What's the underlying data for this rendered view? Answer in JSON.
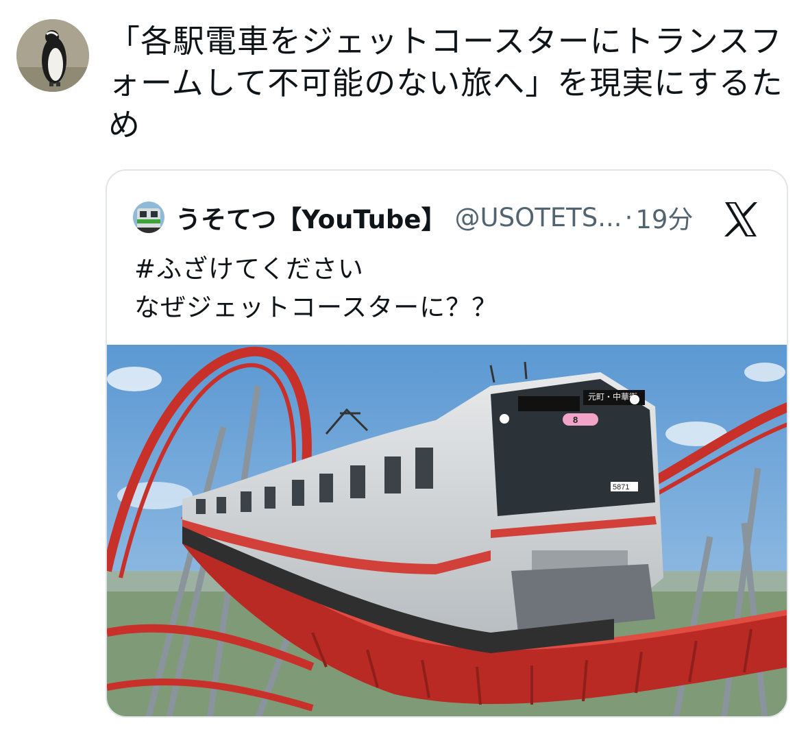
{
  "tweet": {
    "text": "「各駅電車をジェットコースターにトランスフォームして不可能のない旅へ」を現実にするため"
  },
  "quote": {
    "display_name": "うそてつ【YouTube】",
    "handle": "@USOTETS...",
    "separator": "·",
    "time": "19分",
    "text": "#ふざけてください\nなぜジェットコースターに？？",
    "image_caption_text": {
      "car_count": "8",
      "destination": "元町・中華街",
      "car_number": "5871"
    }
  },
  "icons": {
    "avatar": "penguin-avatar",
    "quote_avatar": "green-train-avatar",
    "brand": "x-logo-icon"
  },
  "colors": {
    "text": "#0f1419",
    "muted": "#536471",
    "border": "#e1e5e8",
    "coaster_red": "#c8302a",
    "sky": "#6fa7d8"
  }
}
